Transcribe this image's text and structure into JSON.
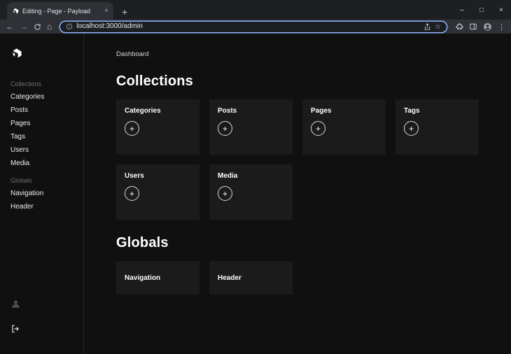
{
  "browser": {
    "tab_title": "Editing - Page - Payload",
    "new_tab_label": "+",
    "url": "localhost:3000/admin",
    "focus_ring_color": "#8ab4f8"
  },
  "sidebar": {
    "collections_label": "Collections",
    "collections": [
      "Categories",
      "Posts",
      "Pages",
      "Tags",
      "Users",
      "Media"
    ],
    "globals_label": "Globals",
    "globals": [
      "Navigation",
      "Header"
    ]
  },
  "main": {
    "breadcrumb": "Dashboard",
    "collections_title": "Collections",
    "collection_cards": [
      {
        "title": "Categories",
        "plus": "+"
      },
      {
        "title": "Posts",
        "plus": "+"
      },
      {
        "title": "Pages",
        "plus": "+"
      },
      {
        "title": "Tags",
        "plus": "+"
      },
      {
        "title": "Users",
        "plus": "+"
      },
      {
        "title": "Media",
        "plus": "+"
      }
    ],
    "globals_title": "Globals",
    "global_cards": [
      {
        "title": "Navigation"
      },
      {
        "title": "Header"
      }
    ]
  },
  "colors": {
    "page_bg": "#101010",
    "card_bg": "#1b1b1b",
    "chrome_bg": "#2f3136"
  }
}
